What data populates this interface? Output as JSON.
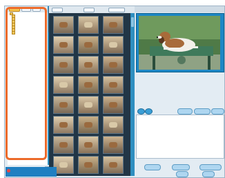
{
  "left_panel": {
    "tabs": [
      "",
      "",
      ""
    ],
    "tree": [
      "",
      "",
      "",
      "",
      "",
      "",
      "",
      ""
    ]
  },
  "thumbnails": {
    "toolbar_buttons": [
      "",
      "",
      ""
    ],
    "count": 24
  },
  "preview": {
    "buttons_top": [
      "",
      "",
      ""
    ],
    "buttons_bottom": [
      "",
      "",
      "",
      "",
      ""
    ]
  },
  "details": {
    "rows": [
      {
        "key": "",
        "value": ""
      },
      {
        "key": "",
        "value": ""
      },
      {
        "key": "",
        "value": ""
      },
      {
        "key": "",
        "value": ""
      },
      {
        "key": "",
        "value": ""
      },
      {
        "key": "",
        "value": ""
      },
      {
        "key": "",
        "value": ""
      },
      {
        "key": "",
        "value": ""
      },
      {
        "key": "",
        "value": ""
      },
      {
        "key": "",
        "value": ""
      },
      {
        "key": "",
        "value": ""
      },
      {
        "key": "",
        "value": ""
      },
      {
        "key": "",
        "value": ""
      },
      {
        "key": "",
        "value": ""
      }
    ]
  },
  "bottom_bar": {
    "app_name": "",
    "subtitle": ""
  },
  "colors": {
    "highlight": "#ec6a2a",
    "accent": "#2f8fc0",
    "thumb_bg": "#223646"
  }
}
